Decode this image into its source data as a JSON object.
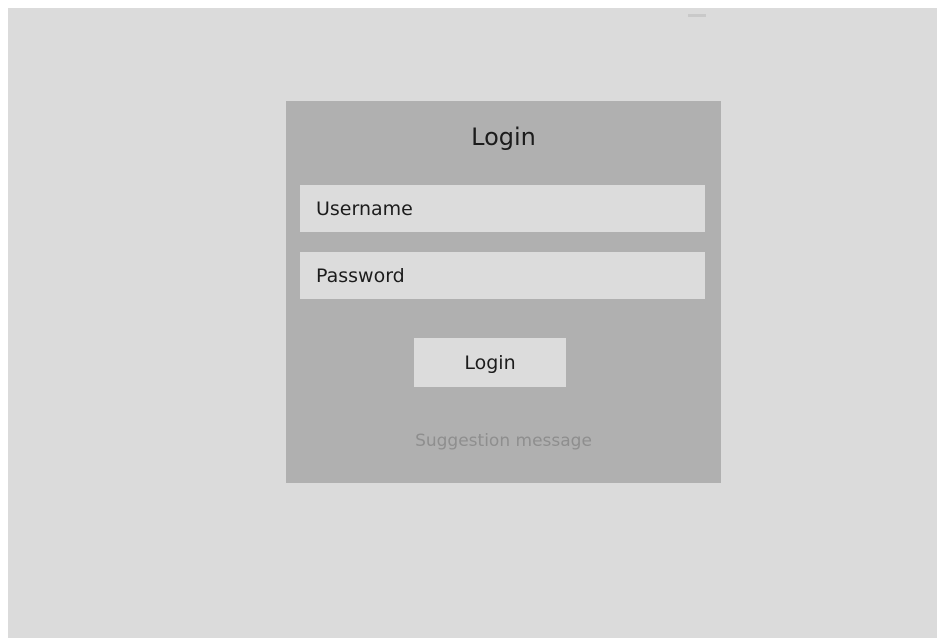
{
  "login": {
    "title": "Login",
    "username_placeholder": "Username",
    "password_placeholder": "Password",
    "button_label": "Login",
    "suggestion": "Suggestion message"
  },
  "colors": {
    "background": "#dbdbdb",
    "card": "#b0b0b0",
    "field": "#dcdcdc",
    "text": "#1c1c1c",
    "muted_text": "#8e8e8e"
  }
}
